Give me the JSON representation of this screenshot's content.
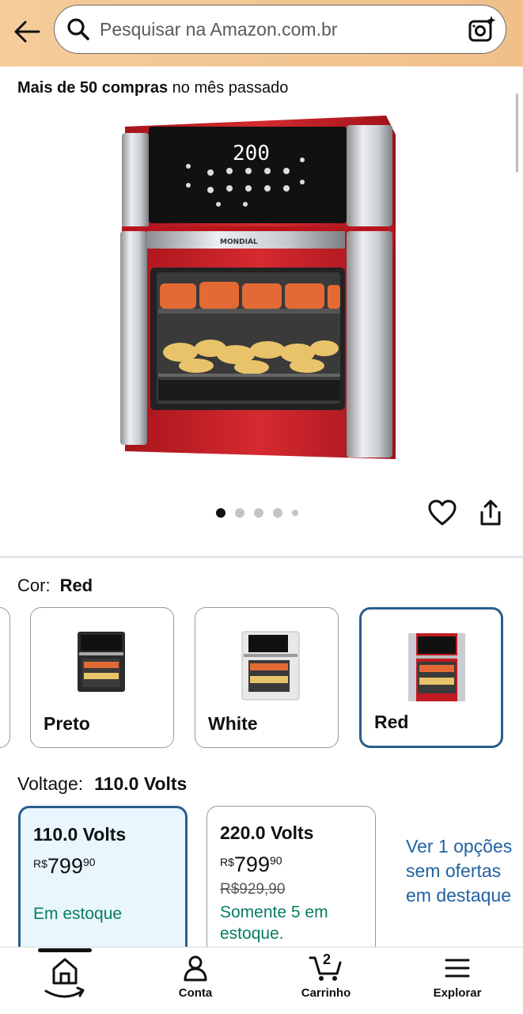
{
  "search": {
    "placeholder": "Pesquisar na Amazon.com.br"
  },
  "purchases": {
    "bold": "Mais de 50 compras",
    "rest": "no mês passado"
  },
  "gallery": {
    "dot_count": 5,
    "active_index": 0
  },
  "color": {
    "label": "Cor:",
    "selected": "Red",
    "options": [
      {
        "label": "Preto",
        "swatch": "#2b2b2b"
      },
      {
        "label": "White",
        "swatch": "#e8e8e8"
      },
      {
        "label": "Red",
        "swatch": "#c01a22"
      }
    ]
  },
  "voltage": {
    "label": "Voltage:",
    "selected": "110.0 Volts",
    "options": [
      {
        "title": "110.0 Volts",
        "currency": "R$",
        "price_int": "799",
        "price_dec": "90",
        "old_price": "",
        "stock": "Em estoque"
      },
      {
        "title": "220.0 Volts",
        "currency": "R$",
        "price_int": "799",
        "price_dec": "90",
        "old_price": "R$929,90",
        "stock": "Somente 5 em estoque."
      }
    ],
    "see_more": "Ver 1 opções sem ofertas em destaque"
  },
  "nav": {
    "home": "",
    "account": "Conta",
    "cart": "Carrinho",
    "cart_count": "2",
    "explore": "Explorar"
  },
  "colors": {
    "accent_border": "#2a5d8f",
    "link": "#2162a1",
    "in_stock": "#067d62",
    "topbar": "#f3c690"
  }
}
